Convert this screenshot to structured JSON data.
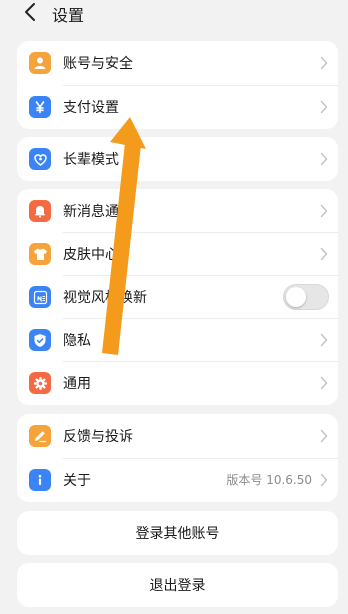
{
  "header": {
    "title": "设置",
    "back_icon": "chevron-left-icon"
  },
  "groups": [
    {
      "items": [
        {
          "label": "账号与安全",
          "icon": "user-icon",
          "color": "#f5a33a"
        },
        {
          "label": "支付设置",
          "icon": "yen-icon",
          "color": "#3a84f5"
        }
      ]
    },
    {
      "items": [
        {
          "label": "长辈模式",
          "icon": "heart-icon",
          "color": "#3a84f5"
        }
      ]
    },
    {
      "items": [
        {
          "label": "新消息通知",
          "icon": "bell-icon",
          "color": "#f46a42"
        },
        {
          "label": "皮肤中心",
          "icon": "shirt-icon",
          "color": "#f5a33a"
        },
        {
          "label": "视觉风格焕新",
          "icon": "new-style-icon",
          "color": "#3a84f5",
          "toggle": false
        },
        {
          "label": "隐私",
          "icon": "shield-icon",
          "color": "#3a84f5"
        },
        {
          "label": "通用",
          "icon": "gear-icon",
          "color": "#f46a42"
        }
      ]
    },
    {
      "items": [
        {
          "label": "反馈与投诉",
          "icon": "pencil-icon",
          "color": "#f5a33a"
        },
        {
          "label": "关于",
          "icon": "info-icon",
          "color": "#3a84f5",
          "value": "版本号 10.6.50"
        }
      ]
    }
  ],
  "buttons": {
    "login_other": "登录其他账号",
    "logout": "退出登录"
  },
  "annotation": {
    "color": "#f59b1c",
    "icon": "arrow-up-icon"
  }
}
